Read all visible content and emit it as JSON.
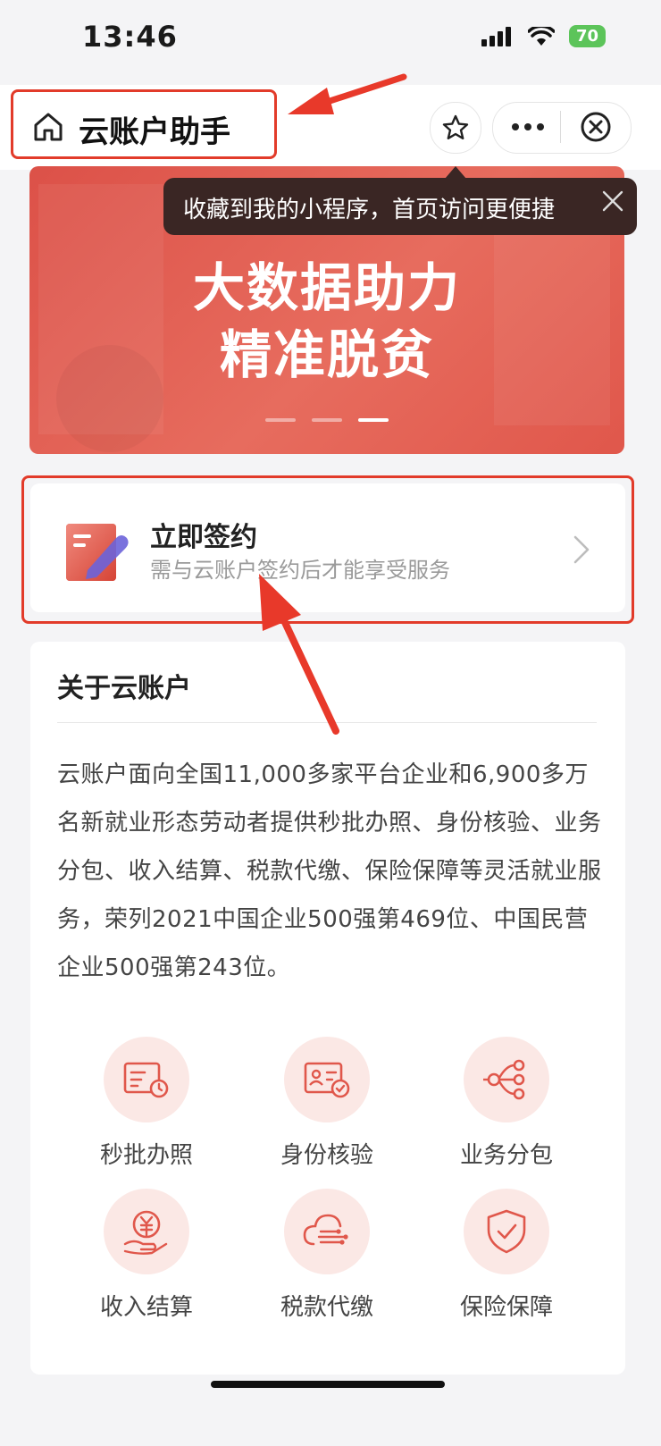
{
  "status_bar": {
    "time": "13:46",
    "battery": "70"
  },
  "header": {
    "title": "云账户助手"
  },
  "tooltip": {
    "text": "收藏到我的小程序，首页访问更便捷"
  },
  "banner": {
    "line1": "大数据助力",
    "line2": "精准脱贫",
    "active_slide": 3,
    "slide_count": 3
  },
  "sign_card": {
    "title": "立即签约",
    "subtitle": "需与云账户签约后才能享受服务"
  },
  "about": {
    "title": "关于云账户",
    "body": "云账户面向全国11,000多家平台企业和6,900多万名新就业形态劳动者提供秒批办照、身份核验、业务分包、收入结算、税款代缴、保险保障等灵活就业服务，荣列2021中国企业500强第469位、中国民营企业500强第243位。"
  },
  "services": [
    {
      "label": "秒批办照",
      "icon": "license-icon"
    },
    {
      "label": "身份核验",
      "icon": "id-verify-icon"
    },
    {
      "label": "业务分包",
      "icon": "branch-icon"
    },
    {
      "label": "收入结算",
      "icon": "yuan-hand-icon"
    },
    {
      "label": "税款代缴",
      "icon": "cloud-tax-icon"
    },
    {
      "label": "保险保障",
      "icon": "shield-check-icon"
    }
  ],
  "colors": {
    "accent": "#e0574b",
    "highlight": "#e23b2a",
    "icon_bg": "#fbe8e5"
  }
}
